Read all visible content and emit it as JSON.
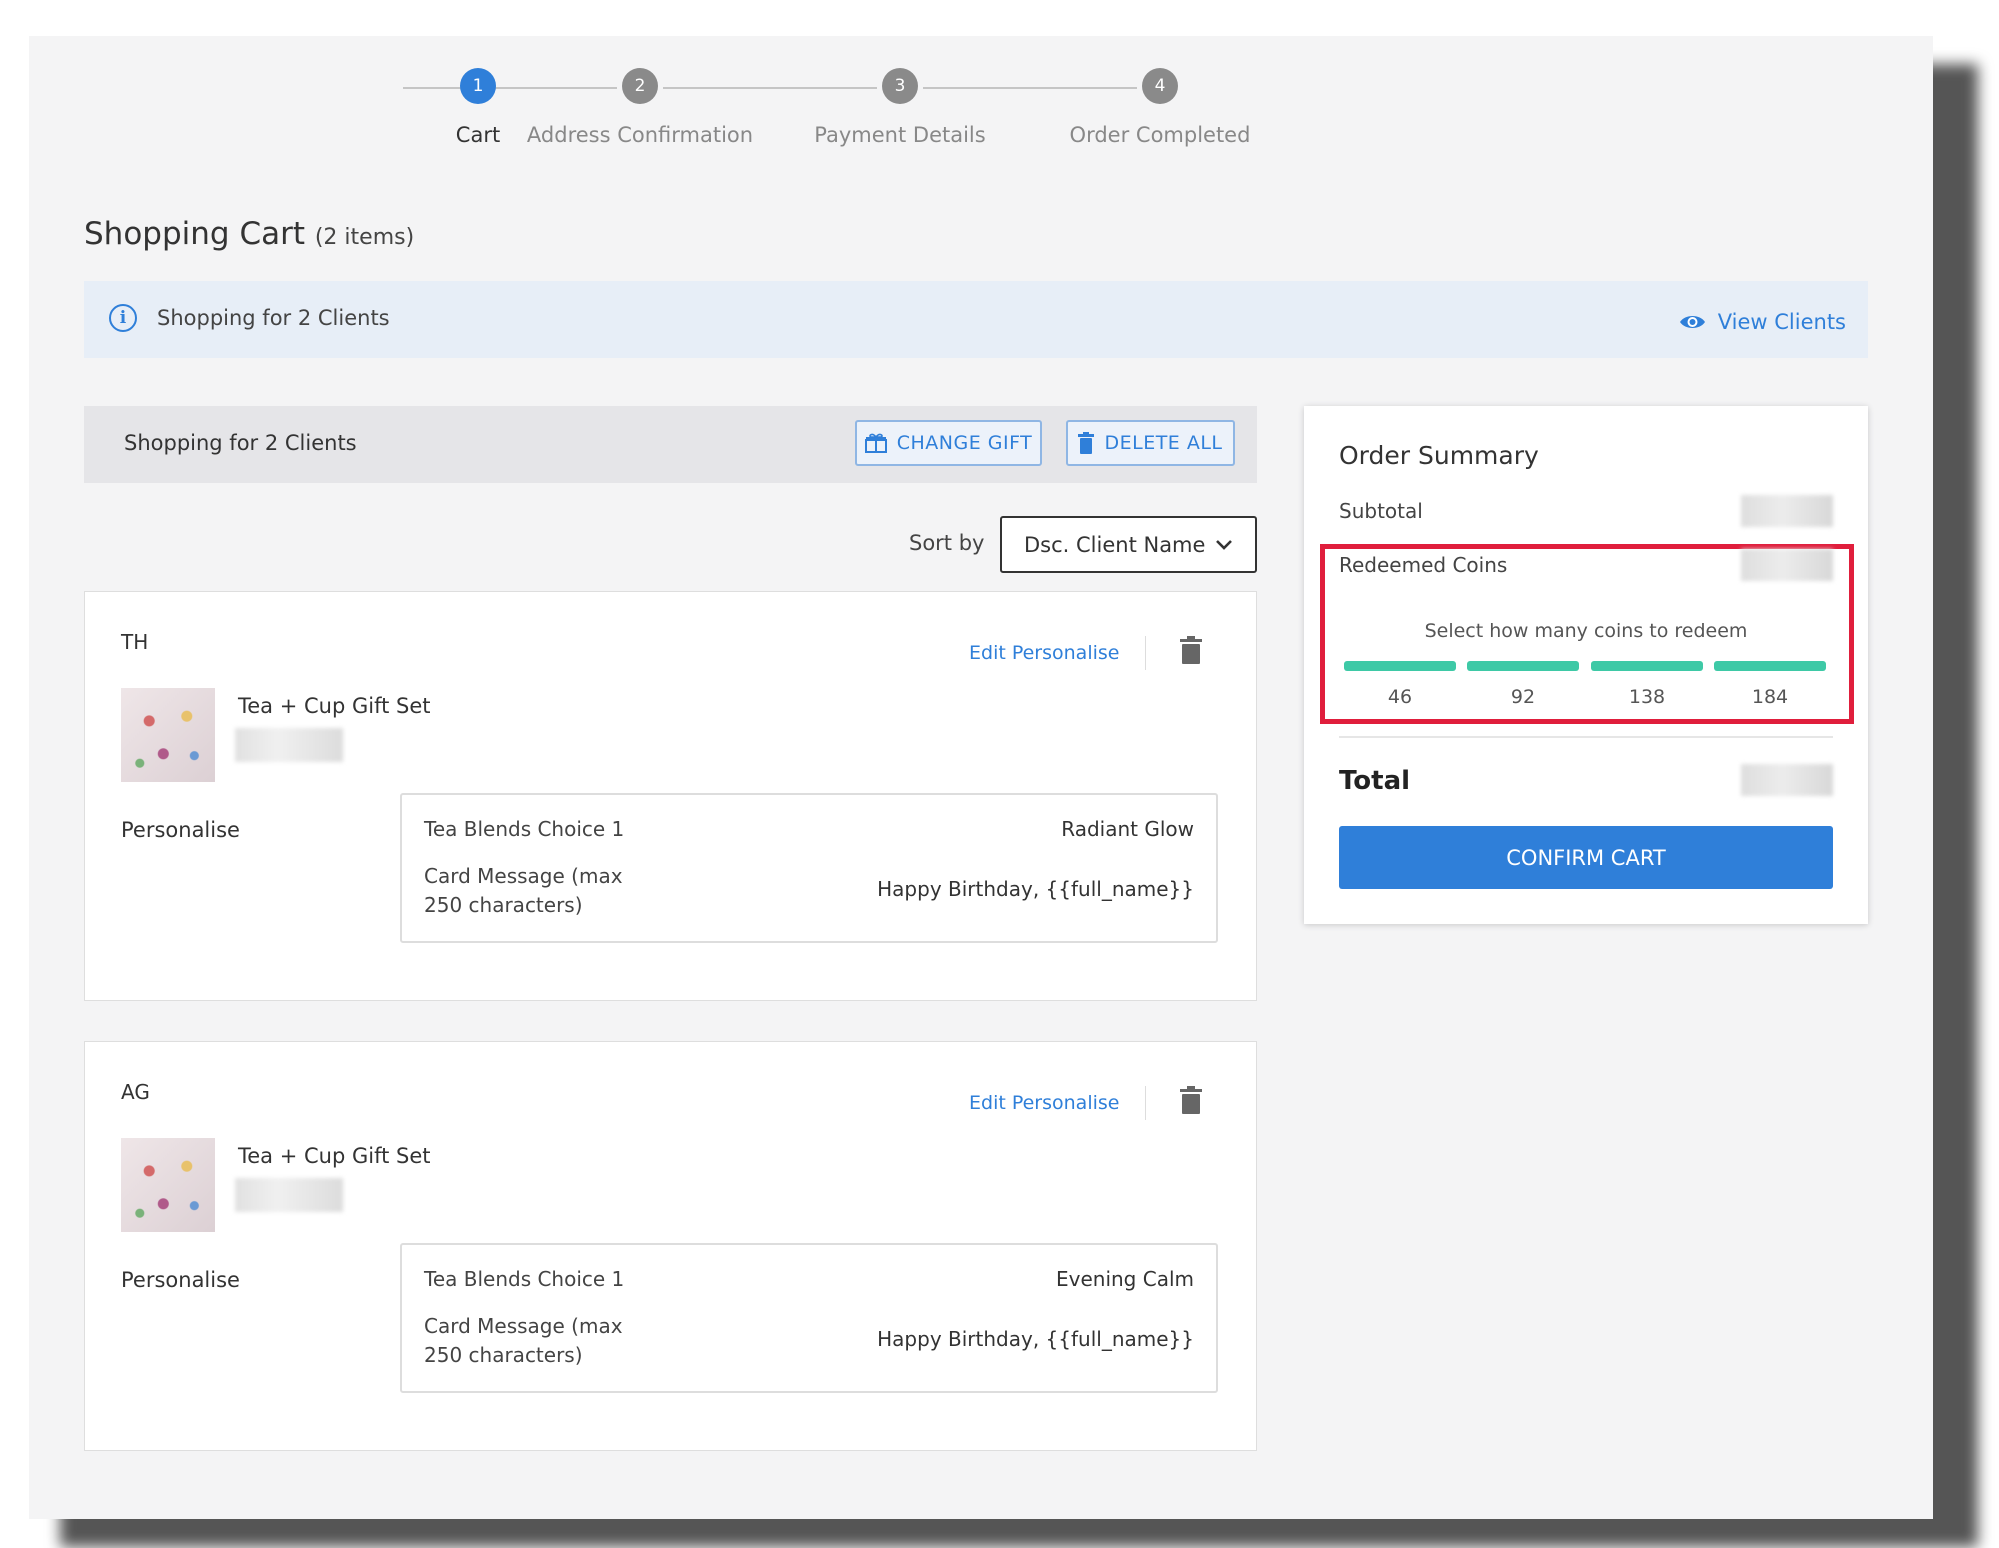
{
  "stepper": {
    "steps": [
      {
        "number": "1",
        "label": "Cart",
        "active": true
      },
      {
        "number": "2",
        "label": "Address Confirmation",
        "active": false
      },
      {
        "number": "3",
        "label": "Payment Details",
        "active": false
      },
      {
        "number": "4",
        "label": "Order Completed",
        "active": false
      }
    ]
  },
  "page": {
    "title": "Shopping Cart",
    "item_count": "(2 items)"
  },
  "banner": {
    "icon": "info-icon",
    "text": "Shopping for 2 Clients",
    "view_clients_label": "View Clients",
    "view_clients_icon": "eye-icon"
  },
  "group": {
    "title": "Shopping for 2 Clients",
    "change_gift_label": "CHANGE GIFT",
    "change_gift_icon": "gift-icon",
    "delete_all_label": "DELETE ALL",
    "delete_all_icon": "trash-icon"
  },
  "sort": {
    "label": "Sort by",
    "selected": "Dsc. Client Name"
  },
  "clients": [
    {
      "initials": "TH",
      "edit_label": "Edit Personalise",
      "product_name": "Tea + Cup Gift Set",
      "personalise_label": "Personalise",
      "choice_label": "Tea Blends Choice 1",
      "choice_value": "Radiant Glow",
      "message_label": "Card Message (max 250 characters)",
      "message_value": "Happy Birthday, {{full_name}}"
    },
    {
      "initials": "AG",
      "edit_label": "Edit Personalise",
      "product_name": "Tea + Cup Gift Set",
      "personalise_label": "Personalise",
      "choice_label": "Tea Blends Choice 1",
      "choice_value": "Evening Calm",
      "message_label": "Card Message (max 250 characters)",
      "message_value": "Happy Birthday, {{full_name}}"
    }
  ],
  "summary": {
    "title": "Order Summary",
    "subtotal_label": "Subtotal",
    "redeemed_label": "Redeemed Coins",
    "coins_caption": "Select how many coins to redeem",
    "coin_options": [
      "46",
      "92",
      "138",
      "184"
    ],
    "total_label": "Total",
    "confirm_label": "CONFIRM CART"
  },
  "colors": {
    "accent": "#2f7fd9",
    "slider": "#3ec9a6",
    "highlight": "#e01e3c",
    "banner_bg": "#e7eef7"
  }
}
